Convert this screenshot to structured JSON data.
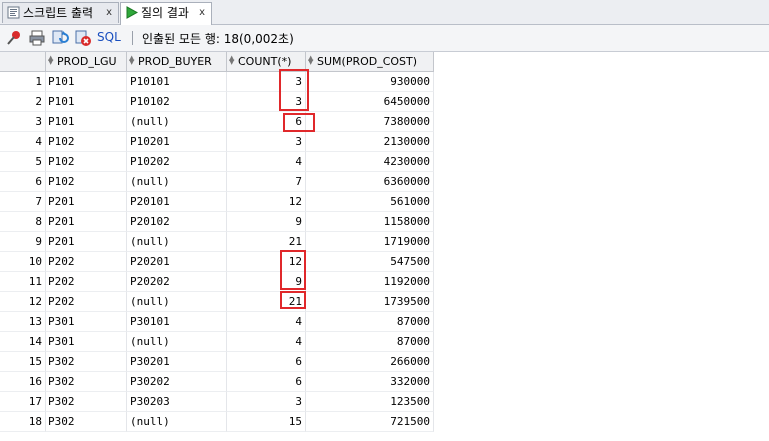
{
  "tabs": [
    {
      "label": "스크립트 출력",
      "close": "x"
    },
    {
      "label": "질의 결과",
      "close": "x"
    }
  ],
  "toolbar": {
    "sql_label": "SQL",
    "status": "인출된 모든 행: 18(0,002초)"
  },
  "columns": [
    "PROD_LGU",
    "PROD_BUYER",
    "COUNT(*)",
    "SUM(PROD_COST)"
  ],
  "rows": [
    {
      "num": "1",
      "lgu": "P101",
      "buyer": "P10101",
      "count": "3",
      "sum": "930000"
    },
    {
      "num": "2",
      "lgu": "P101",
      "buyer": "P10102",
      "count": "3",
      "sum": "6450000"
    },
    {
      "num": "3",
      "lgu": "P101",
      "buyer": "(null)",
      "count": "6",
      "sum": "7380000"
    },
    {
      "num": "4",
      "lgu": "P102",
      "buyer": "P10201",
      "count": "3",
      "sum": "2130000"
    },
    {
      "num": "5",
      "lgu": "P102",
      "buyer": "P10202",
      "count": "4",
      "sum": "4230000"
    },
    {
      "num": "6",
      "lgu": "P102",
      "buyer": "(null)",
      "count": "7",
      "sum": "6360000"
    },
    {
      "num": "7",
      "lgu": "P201",
      "buyer": "P20101",
      "count": "12",
      "sum": "561000"
    },
    {
      "num": "8",
      "lgu": "P201",
      "buyer": "P20102",
      "count": "9",
      "sum": "1158000"
    },
    {
      "num": "9",
      "lgu": "P201",
      "buyer": "(null)",
      "count": "21",
      "sum": "1719000"
    },
    {
      "num": "10",
      "lgu": "P202",
      "buyer": "P20201",
      "count": "12",
      "sum": "547500"
    },
    {
      "num": "11",
      "lgu": "P202",
      "buyer": "P20202",
      "count": "9",
      "sum": "1192000"
    },
    {
      "num": "12",
      "lgu": "P202",
      "buyer": "(null)",
      "count": "21",
      "sum": "1739500"
    },
    {
      "num": "13",
      "lgu": "P301",
      "buyer": "P30101",
      "count": "4",
      "sum": "87000"
    },
    {
      "num": "14",
      "lgu": "P301",
      "buyer": "(null)",
      "count": "4",
      "sum": "87000"
    },
    {
      "num": "15",
      "lgu": "P302",
      "buyer": "P30201",
      "count": "6",
      "sum": "266000"
    },
    {
      "num": "16",
      "lgu": "P302",
      "buyer": "P30202",
      "count": "6",
      "sum": "332000"
    },
    {
      "num": "17",
      "lgu": "P302",
      "buyer": "P30203",
      "count": "3",
      "sum": "123500"
    },
    {
      "num": "18",
      "lgu": "P302",
      "buyer": "(null)",
      "count": "15",
      "sum": "721500"
    }
  ],
  "highlight_color": "#e0282b"
}
